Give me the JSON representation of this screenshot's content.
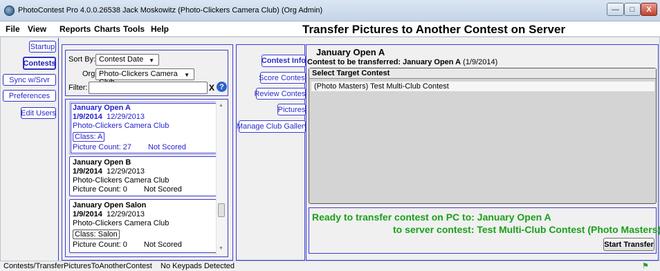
{
  "window": {
    "title": "PhotoContest Pro 4.0.0.26538 Jack Moskowitz (Photo-Clickers Camera Club) (Org Admin)",
    "min_glyph": "—",
    "max_glyph": "□",
    "close_glyph": "X"
  },
  "menu": {
    "items": [
      "File",
      "View",
      "Reports",
      "Charts",
      "Tools",
      "Help"
    ],
    "page_title": "Transfer Pictures to Another Contest on Server"
  },
  "nav": {
    "items": [
      "Startup",
      "Contests",
      "Sync w/Srvr",
      "Preferences",
      "Edit Users"
    ]
  },
  "filters": {
    "sort_label": "Sort By:",
    "sort_value": "Contest Date",
    "org_label": "Org:",
    "org_value": "Photo-Clickers Camera Club",
    "filter_label": "Filter:",
    "filter_value": "",
    "clear_label": "X",
    "help_glyph": "?"
  },
  "contests": [
    {
      "name": "January Open A",
      "date": "1/9/2014",
      "date2": "12/29/2013",
      "club": "Photo-Clickers Camera Club",
      "class": "Class: A",
      "count": "Picture Count: 27",
      "status": "Not Scored"
    },
    {
      "name": "January Open B",
      "date": "1/9/2014",
      "date2": "12/29/2013",
      "club": "Photo-Clickers Camera Club",
      "class": "",
      "count": "Picture Count: 0",
      "status": "Not Scored"
    },
    {
      "name": "January Open Salon",
      "date": "1/9/2014",
      "date2": "12/29/2013",
      "club": "Photo-Clickers Camera Club",
      "class": "Class: Salon",
      "count": "Picture Count: 0",
      "status": "Not Scored"
    }
  ],
  "side_tabs": [
    "Contest Info",
    "Score Contest",
    "Review Contest",
    "Pictures",
    "Manage Club Gallery"
  ],
  "detail": {
    "contest_name": "January Open A",
    "transfer_label": "Contest to be transferred:",
    "transfer_name": "January Open A",
    "transfer_date": "(1/9/2014)",
    "target_header": "Select Target Contest",
    "targets": [
      "(Photo Masters)  Test Multi-Club Contest"
    ],
    "ready_line1": "Ready to transfer contest on PC to: January Open A",
    "ready_line2": "to server contest: Test Multi-Club Contest (Photo Masters)",
    "start_button": "Start Transfer"
  },
  "statusbar": {
    "path": "Contests/TransferPicturesToAnotherContest",
    "keypads": "No Keypads Detected"
  },
  "colors": {
    "accent_blue": "#3c3cd0",
    "ready_green": "#1aa01a"
  }
}
